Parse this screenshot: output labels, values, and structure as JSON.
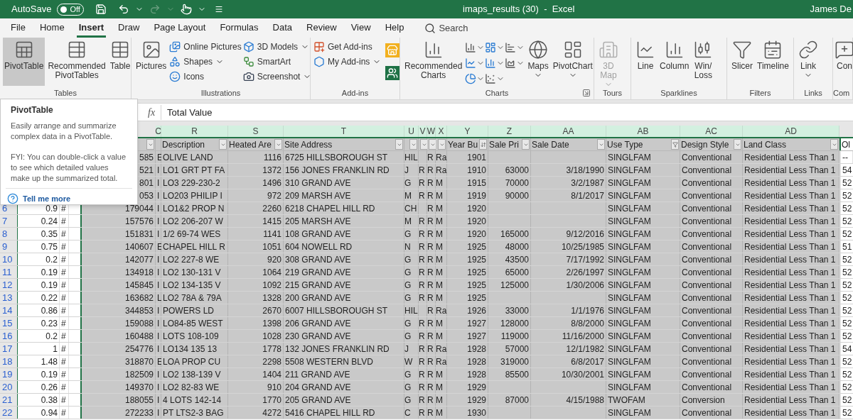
{
  "title_bar": {
    "autosave_label": "AutoSave",
    "autosave_state": "Off",
    "autosave_on": false,
    "title": "imaps_results (30)  -  Excel",
    "user": "James De"
  },
  "menu_tabs": [
    {
      "label": "File",
      "selected": false
    },
    {
      "label": "Home",
      "selected": false
    },
    {
      "label": "Insert",
      "selected": true
    },
    {
      "label": "Draw",
      "selected": false
    },
    {
      "label": "Page Layout",
      "selected": false
    },
    {
      "label": "Formulas",
      "selected": false
    },
    {
      "label": "Data",
      "selected": false
    },
    {
      "label": "Review",
      "selected": false
    },
    {
      "label": "View",
      "selected": false
    },
    {
      "label": "Help",
      "selected": false
    }
  ],
  "search": {
    "placeholder": "Search"
  },
  "ribbon_groups": [
    {
      "label": "Tables",
      "items": [
        {
          "kind": "large",
          "label": "PivotTable",
          "selected": true,
          "disabled": false
        },
        {
          "kind": "large",
          "label": "Recommended PivotTables",
          "selected": false,
          "disabled": false
        },
        {
          "kind": "large",
          "label": "Table",
          "selected": false,
          "disabled": false
        }
      ]
    },
    {
      "label": "Illustrations",
      "items": [
        {
          "kind": "large",
          "label": "Pictures",
          "selected": false,
          "disabled": false
        },
        {
          "kind": "stack",
          "items": [
            {
              "label": "Online Pictures"
            },
            {
              "label": "Shapes",
              "menu": true
            },
            {
              "label": "Icons"
            }
          ]
        },
        {
          "kind": "stack",
          "items": [
            {
              "label": "3D Models",
              "menu": true
            },
            {
              "label": "SmartArt"
            },
            {
              "label": "Screenshot",
              "menu": true
            }
          ]
        }
      ]
    },
    {
      "label": "Add-ins",
      "items": [
        {
          "kind": "stack",
          "items": [
            {
              "label": "Get Add-ins"
            },
            {
              "label": "My Add-ins",
              "menu": true
            }
          ]
        },
        {
          "kind": "icon_stack"
        }
      ]
    },
    {
      "label": "Charts",
      "launcher": true,
      "items": [
        {
          "kind": "large",
          "label": "Recommended Charts",
          "selected": false,
          "disabled": false
        },
        {
          "kind": "chart_icons"
        },
        {
          "kind": "large",
          "label": "Maps",
          "selected": false,
          "menu": true,
          "disabled": false
        },
        {
          "kind": "large",
          "label": "PivotChart",
          "selected": false,
          "menu": true,
          "disabled": false
        }
      ]
    },
    {
      "label": "Tours",
      "items": [
        {
          "kind": "large",
          "label": "3D Map",
          "selected": false,
          "menu": true,
          "disabled": true
        }
      ]
    },
    {
      "label": "Sparklines",
      "items": [
        {
          "kind": "large",
          "label": "Line",
          "selected": false,
          "disabled": false
        },
        {
          "kind": "large",
          "label": "Column",
          "selected": false,
          "disabled": false
        },
        {
          "kind": "large",
          "label": "Win/ Loss",
          "selected": false,
          "disabled": false
        }
      ]
    },
    {
      "label": "Filters",
      "items": [
        {
          "kind": "large",
          "label": "Slicer",
          "selected": false,
          "disabled": false
        },
        {
          "kind": "large",
          "label": "Timeline",
          "selected": false,
          "disabled": false
        }
      ]
    },
    {
      "label": "Links",
      "items": [
        {
          "kind": "large",
          "label": "Link",
          "selected": false,
          "menu": true,
          "disabled": false
        }
      ]
    },
    {
      "label": "Com",
      "items": [
        {
          "kind": "large",
          "label": "Con",
          "selected": false,
          "disabled": false
        }
      ]
    }
  ],
  "tooltip": {
    "title": "PivotTable",
    "text": "Easily arrange and summarize complex data in a PivotTable.",
    "note": "FYI: You can double-click a value to see which detailed values make up the summarized total.",
    "link": "Tell me more"
  },
  "formula_bar": {
    "fx": "fx",
    "value": "Total Value"
  },
  "column_letters": [
    "C",
    "R",
    "S",
    "T",
    "U",
    "V",
    "W",
    "X",
    "Y",
    "Z",
    "AA",
    "AB",
    "AC",
    "AD"
  ],
  "header_row": [
    {
      "kind": "dropdown"
    },
    {
      "kind": "plain"
    },
    {
      "label": "Description",
      "kind": "dropdown"
    },
    {
      "label": "Heated Are",
      "kind": "dropdown"
    },
    {
      "label": "Site Address",
      "kind": "dropdown"
    },
    {
      "kind": "dropdown"
    },
    {
      "kind": "dropdown"
    },
    {
      "kind": "dropdown"
    },
    {
      "kind": "dropdown"
    },
    {
      "label": "Year Bu",
      "kind": "sorted"
    },
    {
      "label": "Sale Pri",
      "kind": "dropdown"
    },
    {
      "label": "Sale Date",
      "kind": "dropdown"
    },
    {
      "label": "Use Type",
      "kind": "filtered"
    },
    {
      "label": "Design Style",
      "kind": "dropdown"
    },
    {
      "label": "Land Class",
      "kind": "dropdown"
    },
    {
      "label": "Ol",
      "kind": "plain"
    }
  ],
  "rows": [
    {
      "cells": [
        null,
        null,
        "585",
        "E",
        "OLIVE LAND",
        "1116",
        "6725 HILLSBOROUGH ST",
        "HIL",
        null,
        "R",
        "Ra",
        "1901",
        null,
        null,
        "SINGLFAM",
        "Conventional",
        "Residential Less Than 1",
        "--"
      ]
    },
    {
      "cells": [
        null,
        null,
        "521",
        "I",
        "LO1 GRT PT FA",
        "1372",
        "156 JONES FRANKLIN RD",
        "J",
        "R",
        "R",
        "Ra",
        "1910",
        "63000",
        "3/18/1990",
        "SINGLFAM",
        "Conventional",
        "Residential Less Than 1",
        "54"
      ]
    },
    {
      "cells": [
        null,
        null,
        "801",
        "I",
        "LO3 229-230-2",
        "1496",
        "310 GRAND AVE",
        "G",
        "R",
        "R",
        "M",
        "1915",
        "70000",
        "3/2/1987",
        "SINGLFAM",
        "Conventional",
        "Residential Less Than 1",
        "52"
      ]
    },
    {
      "cells": [
        null,
        null,
        "053",
        "I",
        "LO203 PHILIP I",
        "972",
        "209 MARSH AVE",
        "M",
        "R",
        "R",
        "M",
        "1919",
        "90000",
        "8/1/2017",
        "SINGLFAM",
        "Conventional",
        "Residential Less Than 1",
        "52"
      ]
    },
    {
      "row": "6",
      "cells": [
        "0.9",
        "#",
        "179044",
        "I",
        "LO1&2 PROP N",
        "2260",
        "6218 CHAPEL HILL RD",
        "CH",
        null,
        "R",
        "M",
        "1920",
        null,
        null,
        "SINGLFAM",
        "Conventional",
        "Residential Less Than 1",
        "52"
      ]
    },
    {
      "row": "7",
      "cells": [
        "0.24",
        "#",
        "157576",
        "I",
        "LO2 206-207 W",
        "1415",
        "205 MARSH AVE",
        "M",
        "R",
        "R",
        "M",
        "1920",
        null,
        null,
        "SINGLFAM",
        "Conventional",
        "Residential Less Than 1",
        "52"
      ]
    },
    {
      "row": "8",
      "cells": [
        "0.35",
        "#",
        "151831",
        "I",
        "1/2 69-74 WES",
        "1141",
        "108 GRAND AVE",
        "G",
        "R",
        "R",
        "M",
        "1920",
        "165000",
        "9/12/2016",
        "SINGLFAM",
        "Conventional",
        "Residential Less Than 1",
        "52"
      ]
    },
    {
      "row": "9",
      "cells": [
        "0.75",
        "#",
        "140607",
        "E",
        "CHAPEL HILL R",
        "1051",
        "604 NOWELL RD",
        "N",
        "R",
        "R",
        "M",
        "1925",
        "48000",
        "10/25/1985",
        "SINGLFAM",
        "Conventional",
        "Residential Less Than 1",
        "51"
      ]
    },
    {
      "row": "10",
      "cells": [
        "0.2",
        "#",
        "142077",
        "I",
        "LO2 227-8 WE",
        "920",
        "308 GRAND AVE",
        "G",
        "R",
        "R",
        "M",
        "1925",
        "43500",
        "7/17/1992",
        "SINGLFAM",
        "Conventional",
        "Residential Less Than 1",
        "52"
      ]
    },
    {
      "row": "11",
      "cells": [
        "0.19",
        "#",
        "134918",
        "I",
        "LO2 130-131 V",
        "1064",
        "219 GRAND AVE",
        "G",
        "R",
        "R",
        "M",
        "1925",
        "65000",
        "2/26/1997",
        "SINGLFAM",
        "Conventional",
        "Residential Less Than 1",
        "52"
      ]
    },
    {
      "row": "12",
      "cells": [
        "0.19",
        "#",
        "145845",
        "I",
        "LO2 134-135 V",
        "1092",
        "215 GRAND AVE",
        "G",
        "R",
        "R",
        "M",
        "1925",
        "125000",
        "1/30/2006",
        "SINGLFAM",
        "Conventional",
        "Residential Less Than 1",
        "52"
      ]
    },
    {
      "row": "13",
      "cells": [
        "0.22",
        "#",
        "163682",
        "L",
        "LO2 78A & 79A",
        "1328",
        "200 GRAND AVE",
        "G",
        "R",
        "R",
        "M",
        "1925",
        null,
        null,
        "SINGLFAM",
        "Conventional",
        "Residential Less Than 1",
        "52"
      ]
    },
    {
      "row": "14",
      "cells": [
        "0.86",
        "#",
        "344853",
        "I",
        "POWERS LD",
        "2670",
        "6007 HILLSBOROUGH ST",
        "HIL",
        null,
        "R",
        "Ra",
        "1926",
        "33000",
        "1/1/1976",
        "SINGLFAM",
        "Conventional",
        "Residential Less Than 1",
        "52"
      ]
    },
    {
      "row": "15",
      "cells": [
        "0.23",
        "#",
        "159088",
        "I",
        "LO84-85 WEST",
        "1398",
        "206 GRAND AVE",
        "G",
        "R",
        "R",
        "M",
        "1927",
        "128000",
        "8/8/2000",
        "SINGLFAM",
        "Conventional",
        "Residential Less Than 1",
        "52"
      ]
    },
    {
      "row": "16",
      "cells": [
        "0.2",
        "#",
        "160488",
        "I",
        "LOTS 108-109",
        "1028",
        "230 GRAND AVE",
        "G",
        "R",
        "R",
        "M",
        "1927",
        "119000",
        "11/16/2000",
        "SINGLFAM",
        "Conventional",
        "Residential Less Than 1",
        "52"
      ]
    },
    {
      "row": "17",
      "cells": [
        "1",
        "#",
        "254776",
        "I",
        "LO134 135 13",
        "1778",
        "132 JONES FRANKLIN RD",
        "J",
        "R",
        "R",
        "Ra",
        "1928",
        "57000",
        "12/1/1982",
        "SINGLFAM",
        "Conventional",
        "Residential Less Than 1",
        "54"
      ]
    },
    {
      "row": "18",
      "cells": [
        "1.48",
        "#",
        "318870",
        "E",
        "LOA PROP CU",
        "2298",
        "5508 WESTERN BLVD",
        "W",
        "R",
        "R",
        "Ra",
        "1928",
        "319000",
        "6/8/2017",
        "SINGLFAM",
        "Conventional",
        "Residential Less Than 1",
        "52"
      ]
    },
    {
      "row": "19",
      "cells": [
        "0.19",
        "#",
        "182509",
        "I",
        "LO2 138-139 V",
        "1404",
        "211 GRAND AVE",
        "G",
        "R",
        "R",
        "M",
        "1928",
        "85500",
        "10/30/2001",
        "SINGLFAM",
        "Conventional",
        "Residential Less Than 1",
        "52"
      ]
    },
    {
      "row": "20",
      "cells": [
        "0.26",
        "#",
        "149370",
        "I",
        "LO2 82-83 WE",
        "910",
        "204 GRAND AVE",
        "G",
        "R",
        "R",
        "M",
        "1929",
        null,
        null,
        "SINGLFAM",
        "Conventional",
        "Residential Less Than 1",
        "52"
      ]
    },
    {
      "row": "21",
      "cells": [
        "0.38",
        "#",
        "188055",
        "I",
        "4 LOTS 142-14",
        "1770",
        "205 GRAND AVE",
        "G",
        "R",
        "R",
        "M",
        "1929",
        "87000",
        "4/15/1988",
        "TWOFAM",
        "Conversion",
        "Residential Less Than 1",
        "52"
      ]
    },
    {
      "row": "22",
      "cells": [
        "0.94",
        "#",
        "272233",
        "I",
        "PT LTS2-3 BAG",
        "4272",
        "5416 CHAPEL HILL RD",
        "C",
        "R",
        "R",
        "M",
        "1930",
        null,
        null,
        "SINGLFAM",
        "Conventional",
        "Residential Less Than 1",
        "52"
      ]
    }
  ]
}
